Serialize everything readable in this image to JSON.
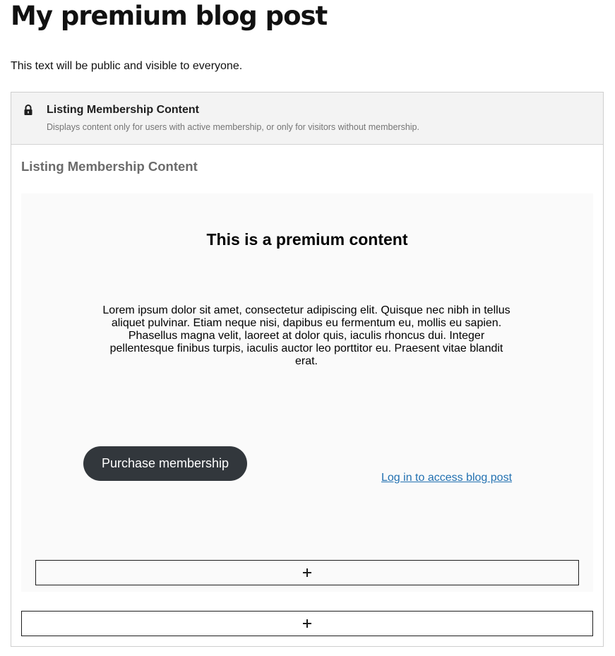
{
  "post": {
    "title": "My premium blog post",
    "public_text": "This text will be public and visible to everyone."
  },
  "block": {
    "header_title": "Listing Membership Content",
    "header_description": "Displays content only for users with active membership, or only for visitors without membership.",
    "header_icon": "lock-icon",
    "content_label": "Listing Membership Content"
  },
  "premium": {
    "title": "This is a premium content",
    "body": "Lorem ipsum dolor sit amet, consectetur adipiscing elit. Quisque nec nibh in tellus aliquet pulvinar. Etiam neque nisi, dapibus eu fermentum eu, mollis eu sapien. Phasellus magna velit, laoreet at dolor quis, iaculis rhoncus dui. Integer pellentesque finibus turpis, iaculis auctor leo porttitor eu. Praesent vitae blandit erat.",
    "purchase_button_label": "Purchase membership",
    "login_link_label": "Log in to access blog post"
  },
  "appenders": {
    "inner_icon": "plus-icon",
    "outer_icon": "plus-icon"
  },
  "colors": {
    "button_bg": "#32373c",
    "link": "#2271b1",
    "header_bg": "#f3f3f3",
    "premium_bg": "#fafafa"
  }
}
